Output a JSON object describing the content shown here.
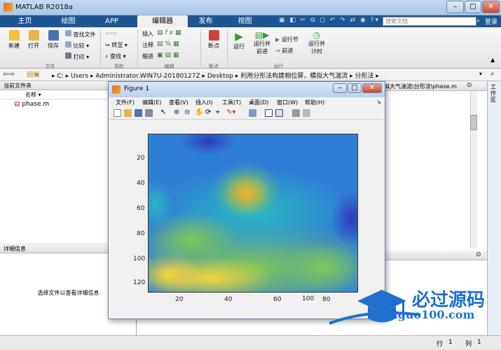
{
  "app": {
    "title": "MATLAB R2018a",
    "search_placeholder": "搜索文档",
    "login": "登录"
  },
  "tabs": [
    "主页",
    "绘图",
    "APP",
    "编辑器",
    "发布",
    "视图"
  ],
  "ribbon": {
    "file": {
      "new": "新建",
      "open": "打开",
      "save": "保存",
      "find_files": "查找文件",
      "compare": "比较",
      "print": "打印",
      "group": "文件"
    },
    "nav": {
      "goto": "转至",
      "find": "查找",
      "group": "导航"
    },
    "edit": {
      "insert": "插入",
      "comment": "注释",
      "indent": "缩进",
      "fx": "fx",
      "group": "编辑"
    },
    "breakpoints": {
      "label": "断点",
      "group": "断点"
    },
    "run": {
      "run": "运行",
      "run_advance": "运行并\n前进",
      "run_section": "运行节",
      "advance": "前进",
      "run_time": "运行并\n计时",
      "group": "运行"
    }
  },
  "address": {
    "parts": [
      "C:",
      "Users",
      "Administrator.WIN7U-20180127Z",
      "Desktop",
      "利用分形法构建相位屏，模拟大气湍流",
      "分形法"
    ]
  },
  "left_panel": {
    "title": "当前文件夹",
    "column": "名称",
    "file": "phase.m"
  },
  "detail_panel": {
    "title": "详细信息",
    "hint": "选择文件以查看详细信息"
  },
  "editor": {
    "path": "拟大气湍流\\分形法\\phase.m"
  },
  "right_toolbar": {
    "label": "工作区"
  },
  "figure": {
    "title": "Figure 1",
    "menus": [
      "文件(F)",
      "编辑(E)",
      "查看(V)",
      "插入(I)",
      "工具(T)",
      "桌面(D)",
      "窗口(W)",
      "帮助(H)"
    ],
    "yticks": [
      "20",
      "40",
      "60",
      "80",
      "100",
      "120"
    ],
    "xticks": [
      "20",
      "40",
      "60",
      "80",
      "100"
    ]
  },
  "status": {
    "row_label": "行",
    "row": "1",
    "col_label": "列",
    "col": "1"
  },
  "watermark": {
    "brand": "必过源码",
    "url": "Biguo100.com"
  },
  "colors": {
    "tab_bar": "#1e5694",
    "accent": "#1e5694"
  }
}
